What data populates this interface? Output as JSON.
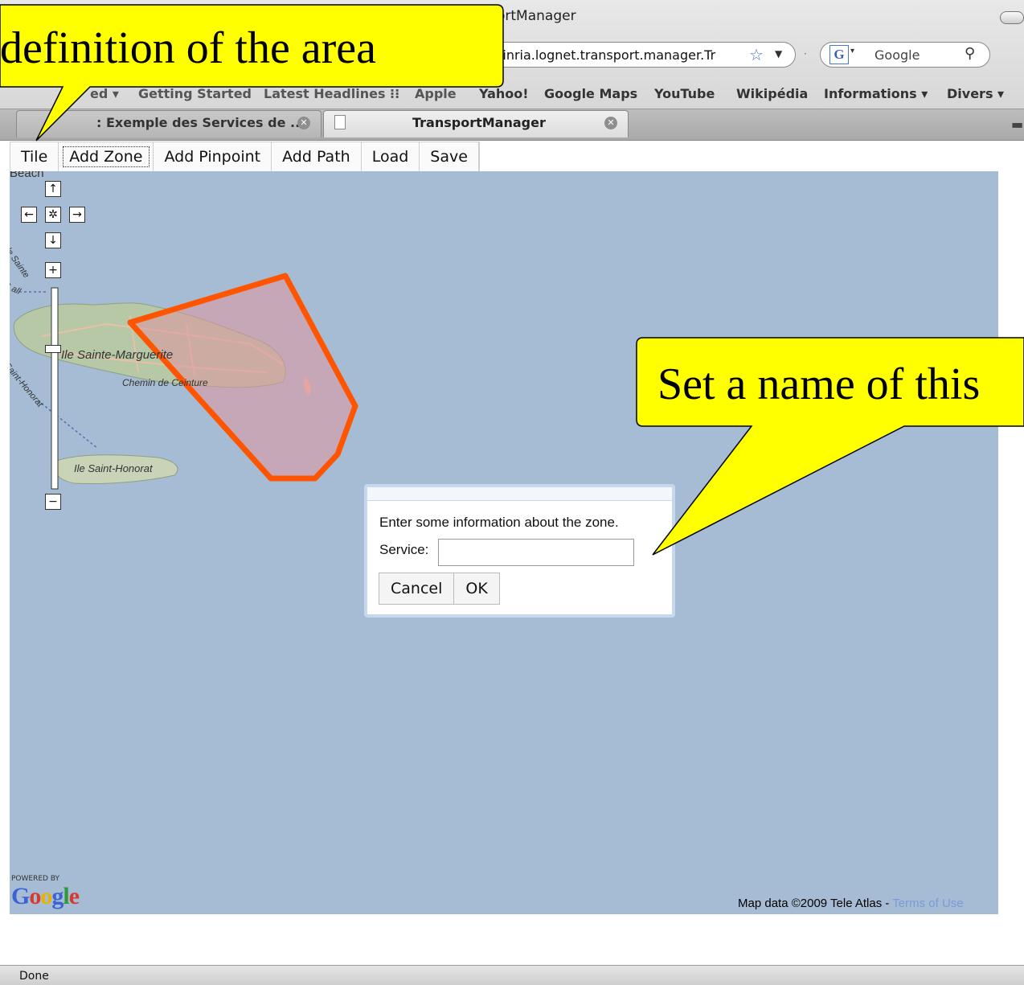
{
  "window": {
    "title": "ortManager"
  },
  "address_bar": {
    "url": "/inria.lognet.transport.manager.Tr"
  },
  "search": {
    "placeholder": "Google"
  },
  "bookmarks": [
    "ed ▾",
    "Getting Started",
    "Latest Headlines ⁝⁝",
    "Apple",
    "Yahoo!",
    "Google Maps",
    "YouTube",
    "Wikipédia",
    "Informations ▾",
    "Divers ▾"
  ],
  "tabs": [
    {
      "label": ": Exemple des Services de ...",
      "active": false
    },
    {
      "label": "TransportManager",
      "active": true
    }
  ],
  "toolbar": {
    "buttons": [
      "Tile",
      "Add Zone",
      "Add Pinpoint",
      "Add Path",
      "Load",
      "Save"
    ],
    "active": "Add Zone"
  },
  "map": {
    "labels": {
      "beach": "Beach",
      "sainte_marguerite": "Ile Sainte-Marguerite",
      "chemin": "Chemin de Ceinture",
      "saint_honorat": "Ile Saint-Honorat",
      "de_sainte": "de Sainte",
      "saint_ho": "Saint-Honorat",
      "s_all": "S all"
    },
    "controls": {
      "pan_up": "↑",
      "pan_left": "←",
      "pan_center": "✲",
      "pan_right": "→",
      "pan_down": "↓",
      "zoom_in": "+",
      "zoom_out": "−"
    },
    "powered_by": "POWERED BY",
    "google": "Google",
    "attribution": "Map data ©2009 Tele Atlas - ",
    "terms": "Terms of Use"
  },
  "dialog": {
    "message": "Enter some information about the zone.",
    "service_label": "Service:",
    "service_value": "",
    "cancel": "Cancel",
    "ok": "OK"
  },
  "callouts": {
    "top": "definition of the area",
    "right": "Set a name of this"
  },
  "status": "Done",
  "colors": {
    "zone_stroke": "#ff5500",
    "zone_fill": "#d9a3ad",
    "map_water": "#a6bcd4",
    "callout": "#ffff00"
  }
}
